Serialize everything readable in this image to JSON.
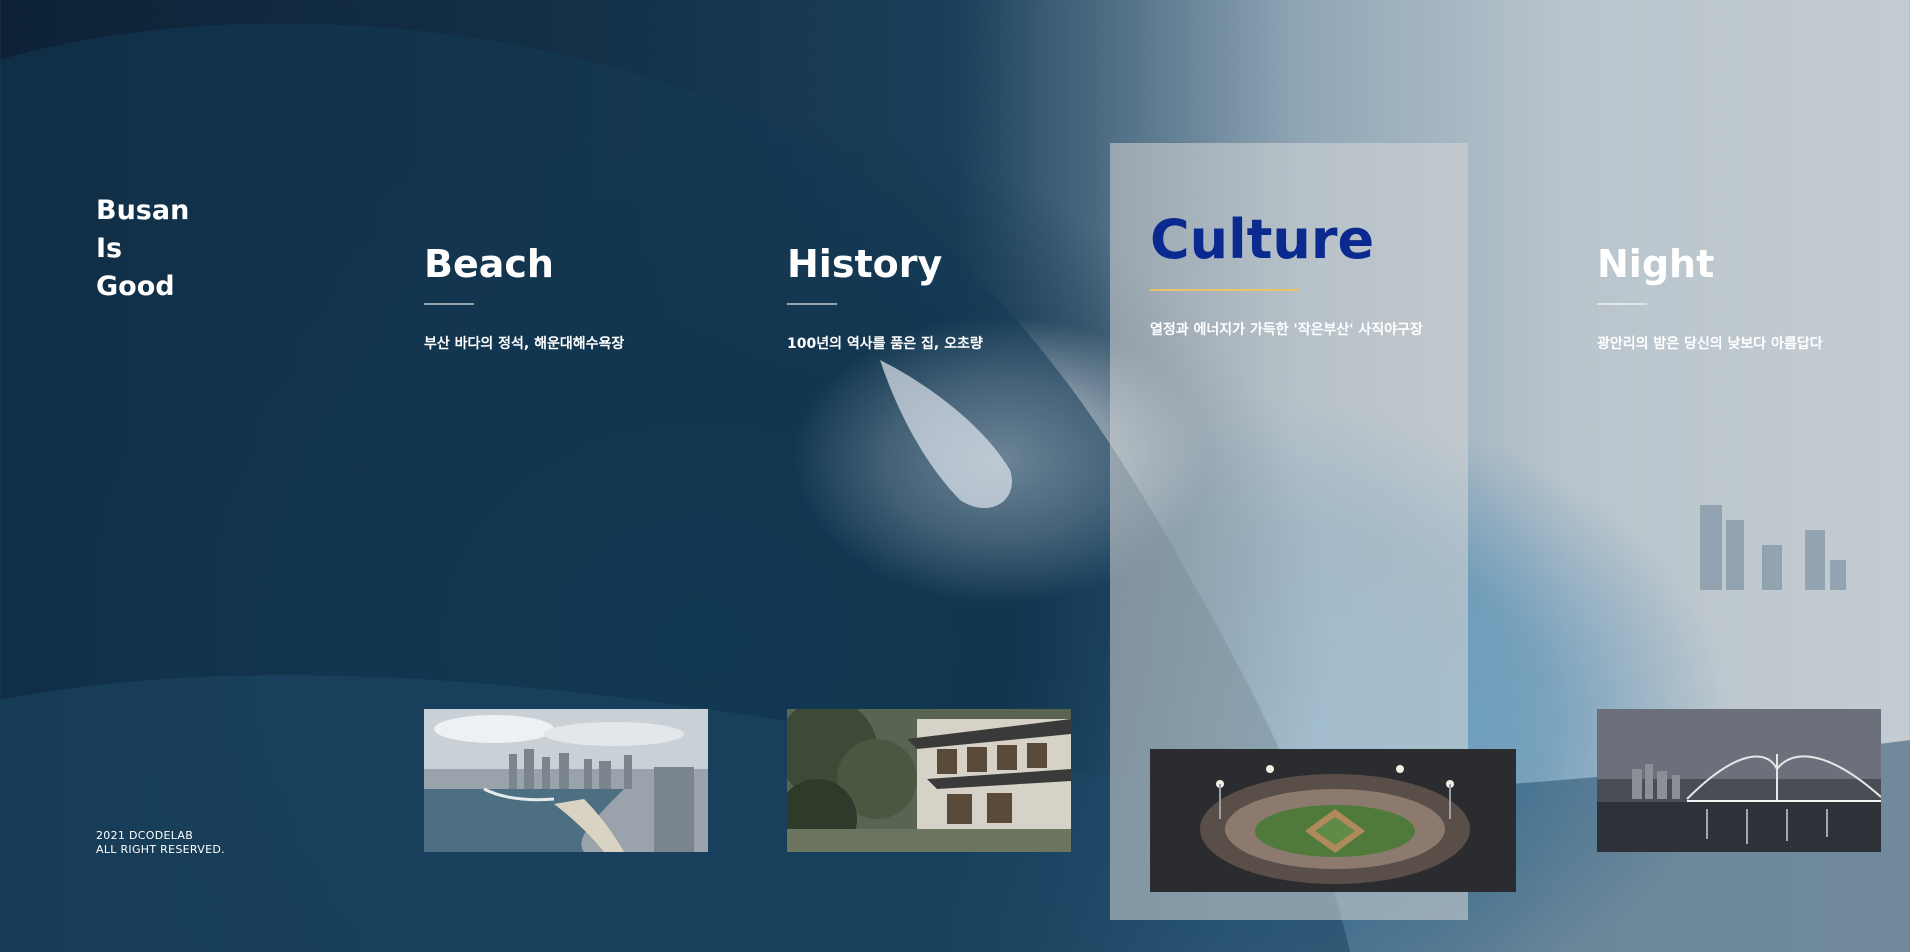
{
  "brand": {
    "line1": "Busan",
    "line2": "Is",
    "line3": "Good"
  },
  "footer": {
    "line1": "2021 DCODELAB",
    "line2": "ALL RIGHT RESERVED."
  },
  "cards": [
    {
      "title": "Beach",
      "desc": "부산 바다의 정석, 해운대해수욕장",
      "image": "haeundae-beach-photo"
    },
    {
      "title": "History",
      "desc": "100년의 역사를 품은 집, 오초량",
      "image": "ochoryang-house-photo"
    },
    {
      "title": "Culture",
      "desc": "열정과 에너지가 가득한 '작은부산' 사직야구장",
      "image": "sajik-baseball-stadium-photo"
    },
    {
      "title": "Night",
      "desc": "광안리의 밤은 당신의 낮보다 아름답다",
      "image": "gwangan-bridge-night-photo"
    }
  ],
  "colors": {
    "accent_title": "#0a2a8f",
    "accent_line": "#e9c46a",
    "active_panel": "#d7d7d7"
  }
}
